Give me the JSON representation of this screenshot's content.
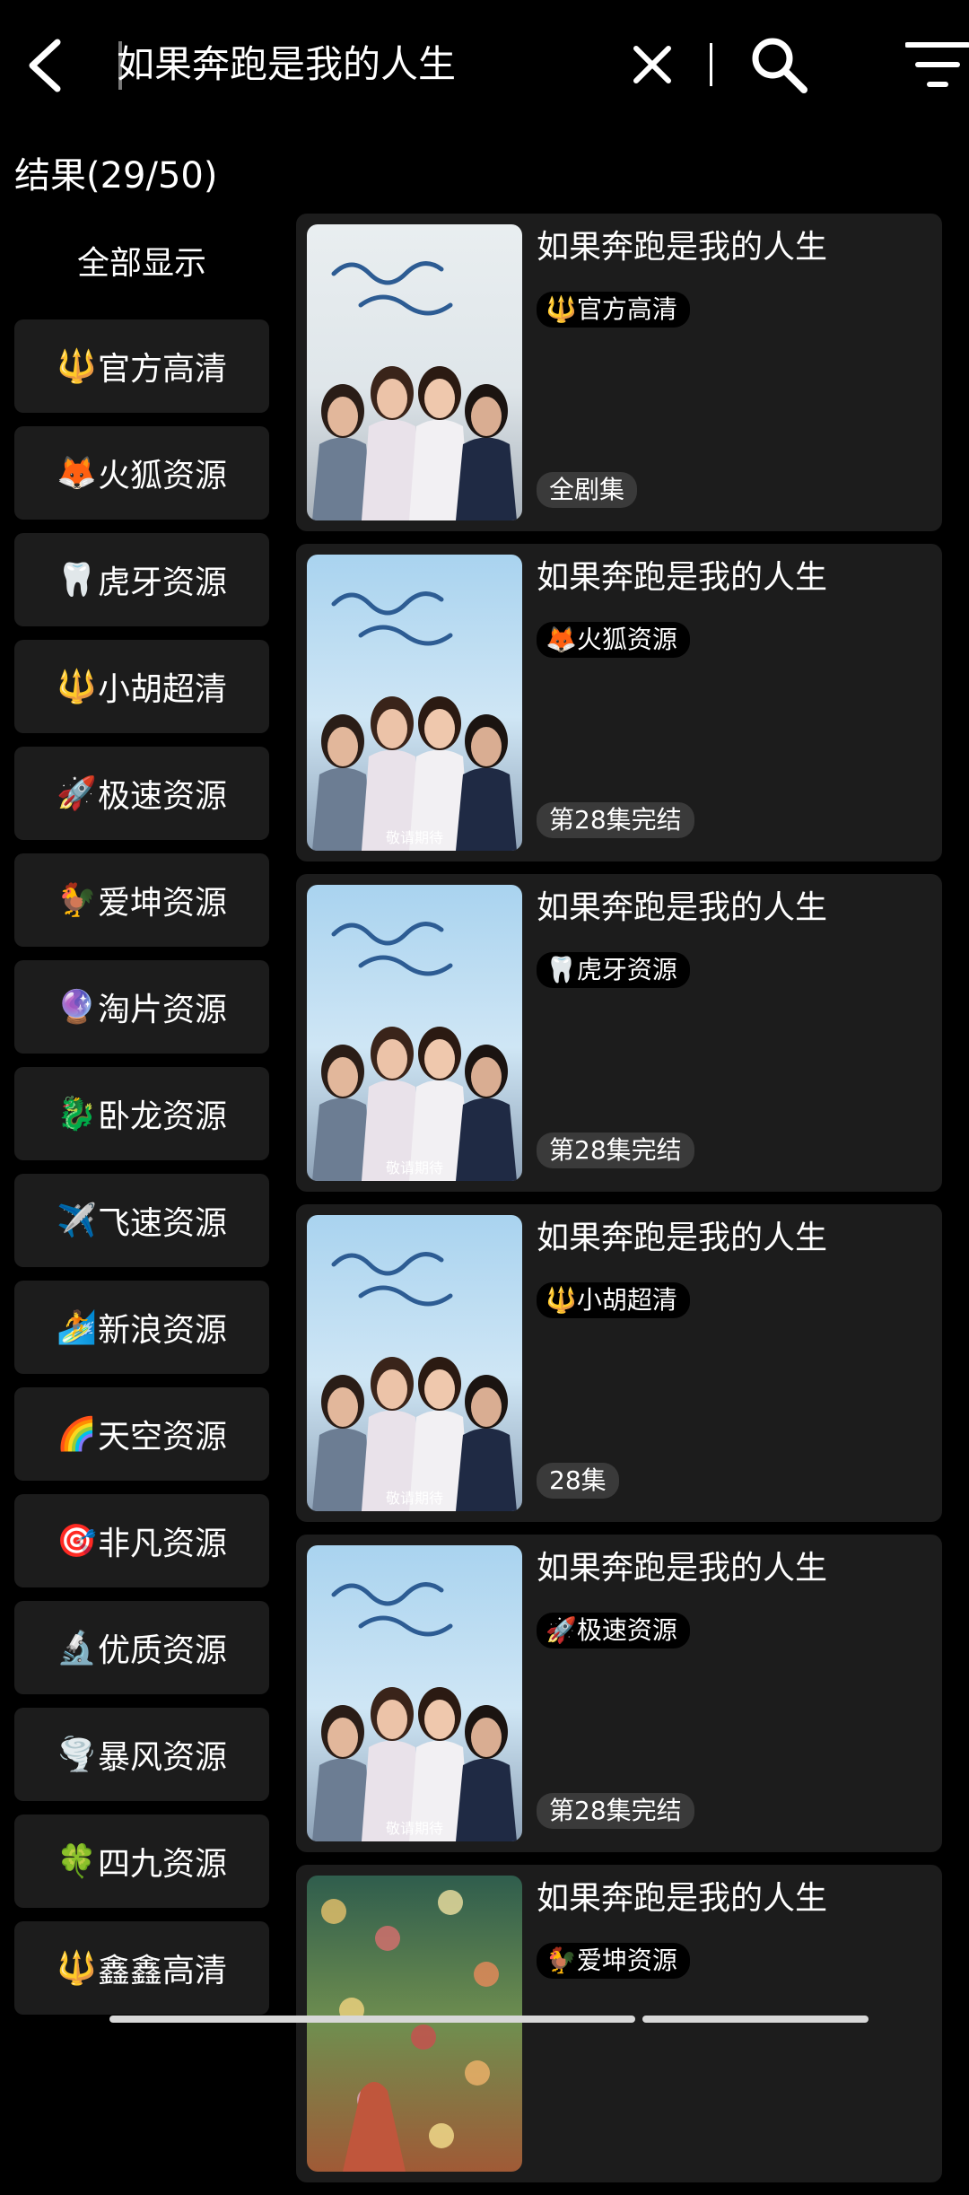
{
  "search": {
    "query": "如果奔跑是我的人生"
  },
  "results_header": {
    "count_text": "结果(29/50)"
  },
  "sidebar": {
    "show_all_label": "全部显示",
    "items": [
      {
        "emoji": "🔱",
        "label": "官方高清"
      },
      {
        "emoji": "🦊",
        "label": "火狐资源"
      },
      {
        "emoji": "🦷",
        "label": "虎牙资源"
      },
      {
        "emoji": "🔱",
        "label": "小胡超清"
      },
      {
        "emoji": "🚀",
        "label": "极速资源"
      },
      {
        "emoji": "🐓",
        "label": "爱坤资源"
      },
      {
        "emoji": "🔮",
        "label": "淘片资源"
      },
      {
        "emoji": "🐉",
        "label": "卧龙资源"
      },
      {
        "emoji": "✈️",
        "label": "飞速资源"
      },
      {
        "emoji": "🏄",
        "label": "新浪资源"
      },
      {
        "emoji": "🌈",
        "label": "天空资源"
      },
      {
        "emoji": "🎯",
        "label": "非凡资源"
      },
      {
        "emoji": "🔬",
        "label": "优质资源"
      },
      {
        "emoji": "🌪️",
        "label": "暴风资源"
      },
      {
        "emoji": "🍀",
        "label": "四九资源"
      },
      {
        "emoji": "🔱",
        "label": "鑫鑫高清"
      }
    ]
  },
  "results": [
    {
      "title": "如果奔跑是我的人生",
      "source": "🔱官方高清",
      "status": "全剧集",
      "poster_caption": "",
      "poster_style": "warm"
    },
    {
      "title": "如果奔跑是我的人生",
      "source": "🦊火狐资源",
      "status": "第28集完结",
      "poster_caption": "敬请期待",
      "poster_style": "sky"
    },
    {
      "title": "如果奔跑是我的人生",
      "source": "🦷虎牙资源",
      "status": "第28集完结",
      "poster_caption": "敬请期待",
      "poster_style": "sky"
    },
    {
      "title": "如果奔跑是我的人生",
      "source": "🔱小胡超清",
      "status": "28集",
      "poster_caption": "敬请期待",
      "poster_style": "sky"
    },
    {
      "title": "如果奔跑是我的人生",
      "source": "🚀极速资源",
      "status": "第28集完结",
      "poster_caption": "敬请期待",
      "poster_style": "sky"
    },
    {
      "title": "如果奔跑是我的人生",
      "source": "🐓爱坤资源",
      "status": "",
      "poster_caption": "",
      "poster_style": "garden"
    }
  ]
}
